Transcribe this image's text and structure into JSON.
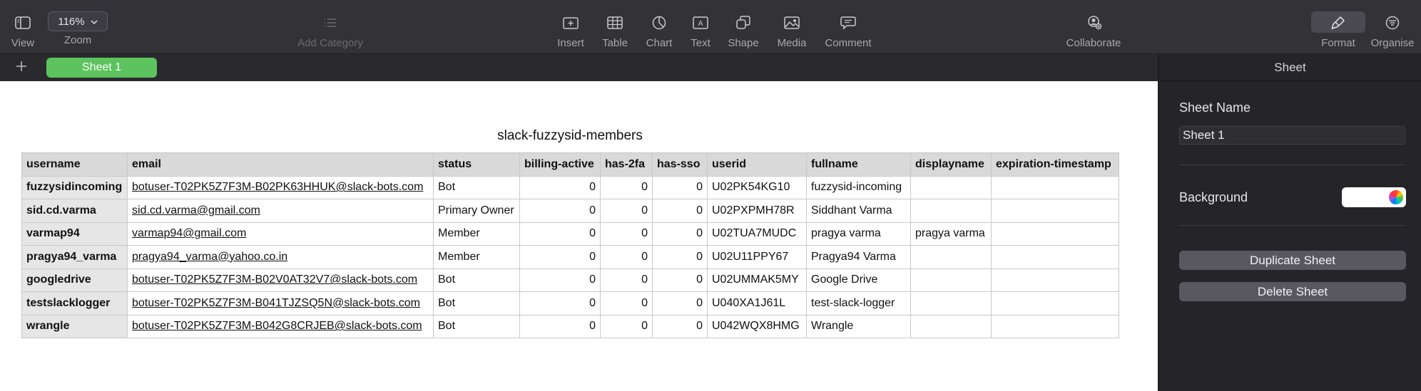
{
  "toolbar": {
    "view": "View",
    "zoom_label": "Zoom",
    "zoom_value": "116%",
    "add_category": "Add Category",
    "insert": "Insert",
    "table": "Table",
    "chart": "Chart",
    "text": "Text",
    "shape": "Shape",
    "media": "Media",
    "comment": "Comment",
    "collaborate": "Collaborate",
    "format": "Format",
    "organise": "Organise",
    "accent": "#5cc35e"
  },
  "tabs": [
    {
      "label": "Sheet 1",
      "active": true
    }
  ],
  "table": {
    "title": "slack-fuzzysid-members",
    "columns": [
      "username",
      "email",
      "status",
      "billing-active",
      "has-2fa",
      "has-sso",
      "userid",
      "fullname",
      "displayname",
      "expiration-timestamp"
    ],
    "rows": [
      [
        "fuzzysidincoming",
        "botuser-T02PK5Z7F3M-B02PK63HHUK@slack-bots.com",
        "Bot",
        "0",
        "0",
        "0",
        "U02PK54KG10",
        "fuzzysid-incoming",
        "",
        ""
      ],
      [
        "sid.cd.varma",
        "sid.cd.varma@gmail.com",
        "Primary Owner",
        "0",
        "0",
        "0",
        "U02PXPMH78R",
        "Siddhant Varma",
        "",
        ""
      ],
      [
        "varmap94",
        "varmap94@gmail.com",
        "Member",
        "0",
        "0",
        "0",
        "U02TUA7MUDC",
        "pragya varma",
        "pragya varma",
        ""
      ],
      [
        "pragya94_varma",
        "pragya94_varma@yahoo.co.in",
        "Member",
        "0",
        "0",
        "0",
        "U02U11PPY67",
        "Pragya94 Varma",
        "",
        ""
      ],
      [
        "googledrive",
        "botuser-T02PK5Z7F3M-B02V0AT32V7@slack-bots.com",
        "Bot",
        "0",
        "0",
        "0",
        "U02UMMAK5MY",
        "Google Drive",
        "",
        ""
      ],
      [
        "testslacklogger",
        "botuser-T02PK5Z7F3M-B041TJZSQ5N@slack-bots.com",
        "Bot",
        "0",
        "0",
        "0",
        "U040XA1J61L",
        "test-slack-logger",
        "",
        ""
      ],
      [
        "wrangle",
        "botuser-T02PK5Z7F3M-B042G8CRJEB@slack-bots.com",
        "Bot",
        "0",
        "0",
        "0",
        "U042WQX8HMG",
        "Wrangle",
        "",
        ""
      ]
    ]
  },
  "sidebar": {
    "header": "Sheet",
    "sheet_name_label": "Sheet Name",
    "sheet_name_value": "Sheet 1",
    "background_label": "Background",
    "background_color": "#ffffff",
    "duplicate_button": "Duplicate Sheet",
    "delete_button": "Delete Sheet"
  }
}
